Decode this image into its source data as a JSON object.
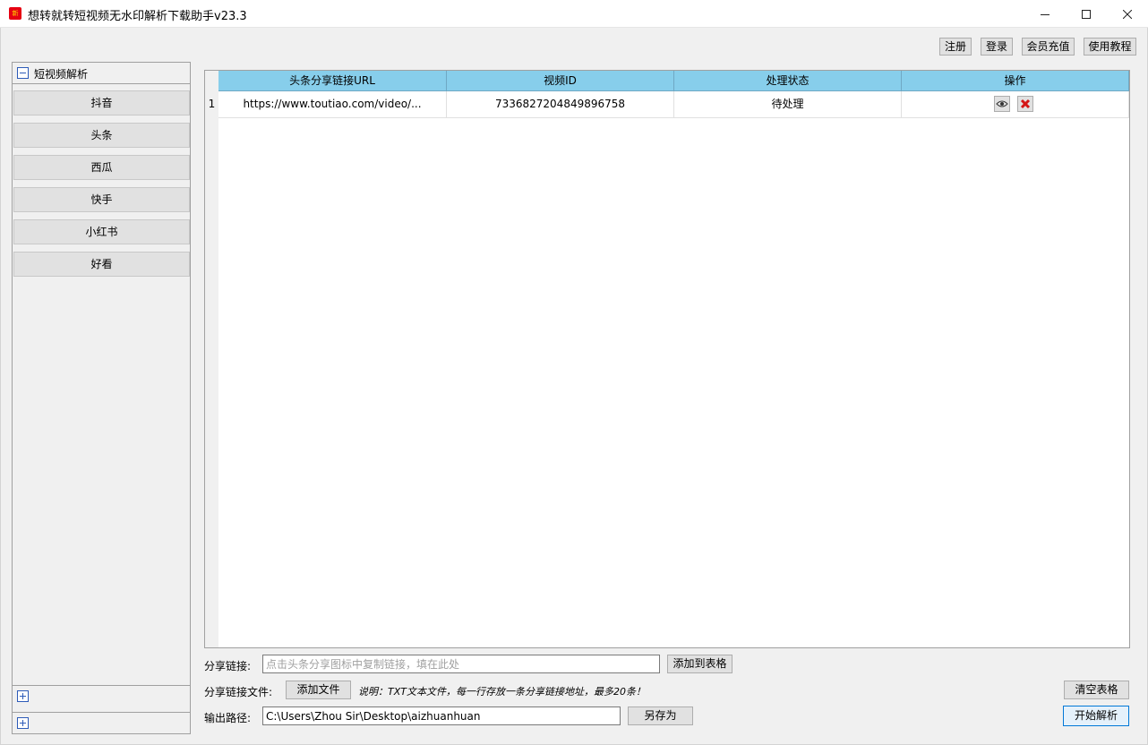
{
  "window": {
    "title": "想转就转短视频无水印解析下载助手v23.3",
    "icon_label": "新"
  },
  "top_buttons": {
    "register": "注册",
    "login": "登录",
    "recharge": "会员充值",
    "tutorial": "使用教程"
  },
  "sidebar": {
    "group_title": "短视频解析",
    "items": [
      {
        "label": "抖音"
      },
      {
        "label": "头条"
      },
      {
        "label": "西瓜"
      },
      {
        "label": "快手"
      },
      {
        "label": "小红书"
      },
      {
        "label": "好看"
      }
    ]
  },
  "table": {
    "headers": [
      "头条分享链接URL",
      "视频ID",
      "处理状态",
      "操作"
    ],
    "rows": [
      {
        "num": "1",
        "url": "https://www.toutiao.com/video/...",
        "video_id": "7336827204849896758",
        "status": "待处理",
        "actions": [
          "eye-icon",
          "delete-icon"
        ]
      }
    ],
    "header_color": "#87ceeb"
  },
  "form": {
    "share_link_label": "分享链接:",
    "share_link_placeholder": "点击头条分享图标中复制链接，填在此处",
    "share_link_value": "",
    "add_to_table": "添加到表格",
    "share_file_label": "分享链接文件:",
    "add_file": "添加文件",
    "file_note": "说明：TXT文本文件，每一行存放一条分享链接地址，最多20条！",
    "clear_table": "清空表格",
    "output_label": "输出路径:",
    "output_path": "C:\\Users\\Zhou Sir\\Desktop\\aizhuanhuan",
    "save_as": "另存为",
    "start": "开始解析"
  }
}
